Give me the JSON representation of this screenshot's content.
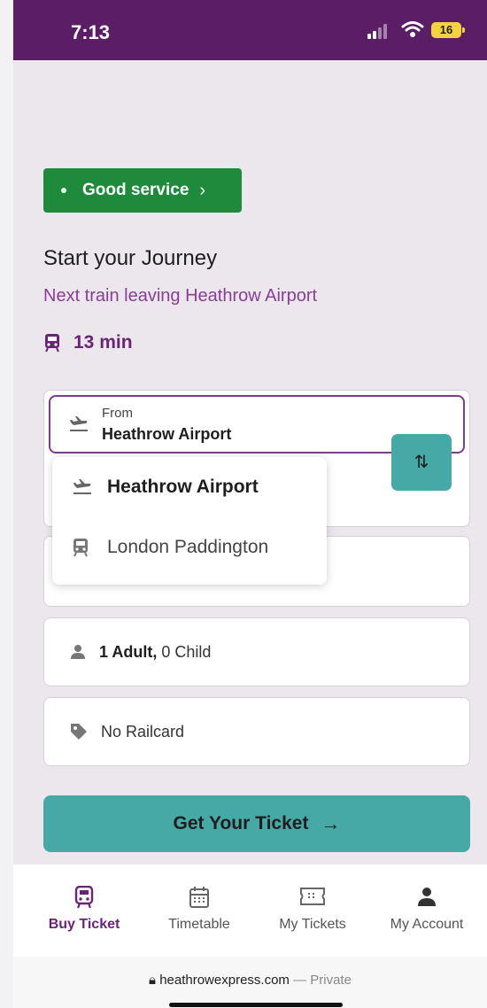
{
  "status_bar": {
    "time": "7:13",
    "battery": "16"
  },
  "service_status": {
    "label": "Good service",
    "color": "#1f8a3c"
  },
  "journey": {
    "title": "Start your Journey",
    "subtitle": "Next train leaving Heathrow Airport",
    "next_train": "13 min"
  },
  "from": {
    "label": "From",
    "value": "Heathrow Airport"
  },
  "station_options": [
    "Heathrow Airport",
    "London Paddington"
  ],
  "passengers": {
    "adults": "1 Adult,",
    "children": "0 Child"
  },
  "railcard": "No Railcard",
  "cta": "Get Your Ticket",
  "tabs": [
    {
      "label": "Buy Ticket",
      "icon": "train-icon"
    },
    {
      "label": "Timetable",
      "icon": "calendar-icon"
    },
    {
      "label": "My Tickets",
      "icon": "ticket-icon"
    },
    {
      "label": "My Account",
      "icon": "user-icon"
    }
  ],
  "browser": {
    "url": "heathrowexpress.com",
    "mode": "— Private"
  },
  "colors": {
    "brand_purple": "#5a1d66",
    "teal": "#46a9a6",
    "service_green": "#1f8a3c"
  }
}
